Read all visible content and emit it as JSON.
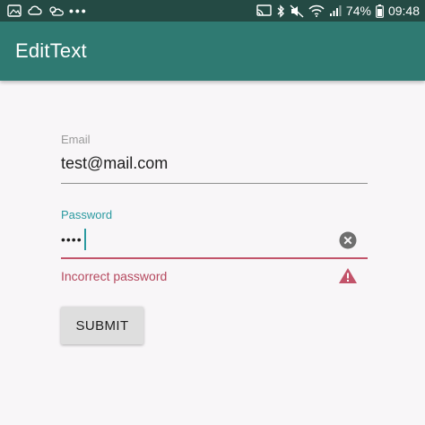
{
  "status_bar": {
    "more_indicator": "•••",
    "battery_text": "74%",
    "time": "09:48",
    "icons": [
      "gallery-icon",
      "cloud-sync-icon",
      "weather-icon",
      "cast-icon",
      "bluetooth-icon",
      "mute-icon",
      "wifi-icon",
      "signal-icon",
      "battery-icon"
    ]
  },
  "app_bar": {
    "title": "EditText"
  },
  "form": {
    "email": {
      "label": "Email",
      "value": "test@mail.com"
    },
    "password": {
      "label": "Password",
      "masked_value": "••••",
      "error": "Incorrect password"
    },
    "submit_label": "SUBMIT"
  },
  "colors": {
    "status_bar": "#244a44",
    "app_bar": "#2f7a72",
    "accent": "#2b9aa0",
    "error": "#c2536a",
    "background": "#f8f6f8"
  }
}
